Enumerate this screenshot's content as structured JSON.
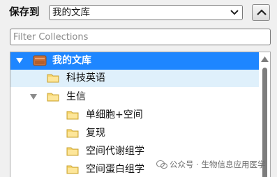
{
  "save_to": {
    "label": "保存到",
    "selected_value": "我的文库"
  },
  "filter": {
    "placeholder": "Filter Collections",
    "value": ""
  },
  "tree": {
    "root": {
      "label": "我的文库",
      "expanded": true,
      "selected": true
    },
    "items": [
      {
        "label": "科技英语",
        "level": 1,
        "has_children": false
      },
      {
        "label": "生信",
        "level": 1,
        "has_children": true,
        "expanded": true
      },
      {
        "label": "单细胞+空间",
        "level": 2,
        "has_children": false
      },
      {
        "label": "复现",
        "level": 2,
        "has_children": false
      },
      {
        "label": "空间代谢组学",
        "level": 2,
        "has_children": false
      },
      {
        "label": "空间蛋白组学",
        "level": 2,
        "has_children": false
      }
    ]
  },
  "watermark": {
    "text": "公众号 · 生物信息应用医学"
  },
  "colors": {
    "selection": "#1e86ff",
    "hover_row": "#dff0fb",
    "folder_fill": "#f7d56b",
    "library_icon": "#c9703a"
  },
  "icons": {
    "collapse_button": "chevron-up-icon",
    "dropdown": "chevron-down-icon",
    "folder": "folder-icon",
    "library": "library-icon"
  }
}
